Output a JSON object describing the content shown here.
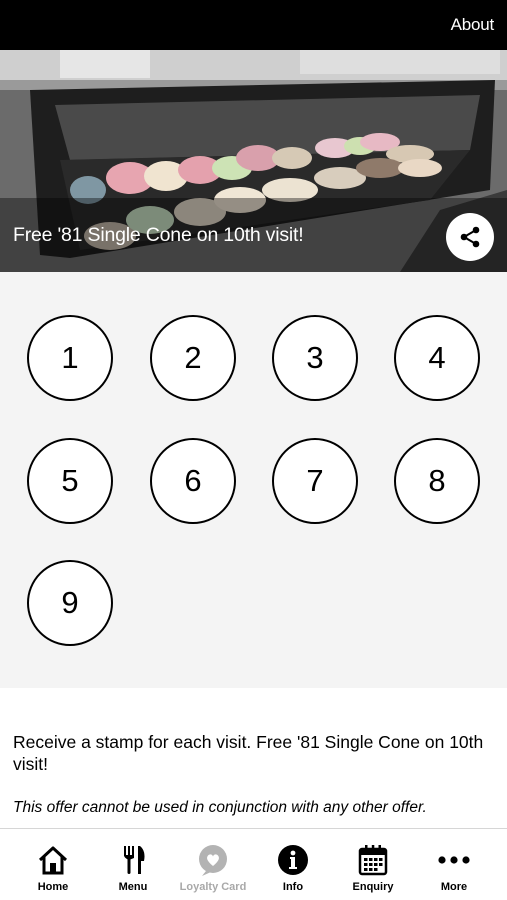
{
  "header": {
    "about_label": "About"
  },
  "hero": {
    "title": "Free '81 Single Cone on 10th visit!"
  },
  "stamps": [
    "1",
    "2",
    "3",
    "4",
    "5",
    "6",
    "7",
    "8",
    "9"
  ],
  "offer": {
    "description": "Receive a stamp for each visit. Free '81 Single Cone on 10th visit!",
    "disclaimer": "This offer cannot be used in conjunction with any other offer."
  },
  "tabs": [
    {
      "label": "Home",
      "icon": "home-icon",
      "active": false
    },
    {
      "label": "Menu",
      "icon": "fork-knife-icon",
      "active": false
    },
    {
      "label": "Loyalty Card",
      "icon": "heart-bubble-icon",
      "active": true
    },
    {
      "label": "Info",
      "icon": "info-icon",
      "active": false
    },
    {
      "label": "Enquiry",
      "icon": "calendar-icon",
      "active": false
    },
    {
      "label": "More",
      "icon": "more-dots-icon",
      "active": false
    }
  ],
  "colors": {
    "topbar": "#000000",
    "stamp_area": "#f4f4f4",
    "tab_muted": "#a9a9a9"
  }
}
